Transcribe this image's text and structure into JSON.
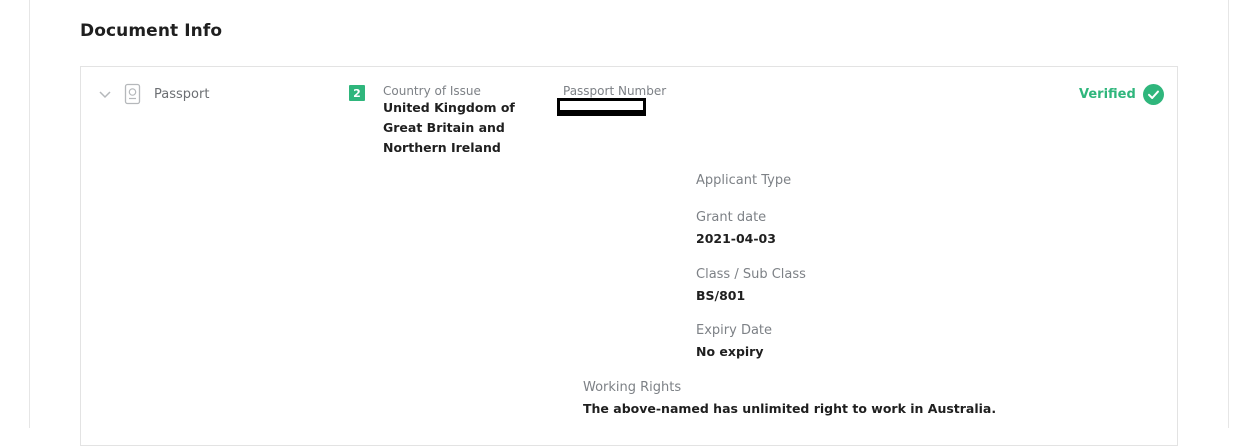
{
  "section": {
    "title": "Document Info"
  },
  "document": {
    "type_label": "Passport",
    "count_badge": "2",
    "country_of_issue": {
      "label": "Country of Issue",
      "value": "United Kingdom of Great Britain and Northern Ireland"
    },
    "passport_number": {
      "label": "Passport Number",
      "value": ""
    },
    "status": {
      "label": "Verified",
      "color": "#2fb67c"
    },
    "applicant_type": {
      "label": "Applicant Type"
    },
    "grant_date": {
      "label": "Grant date",
      "value": "2021-04-03"
    },
    "class_sub_class": {
      "label": "Class / Sub Class",
      "value": "BS/801"
    },
    "expiry_date": {
      "label": "Expiry Date",
      "value": "No expiry"
    },
    "working_rights": {
      "label": "Working Rights",
      "value": "The above-named has unlimited right to work in Australia."
    }
  },
  "icons": {
    "chevron": "chevron-down-icon",
    "document": "passport-icon",
    "verified": "check-circle-icon"
  }
}
